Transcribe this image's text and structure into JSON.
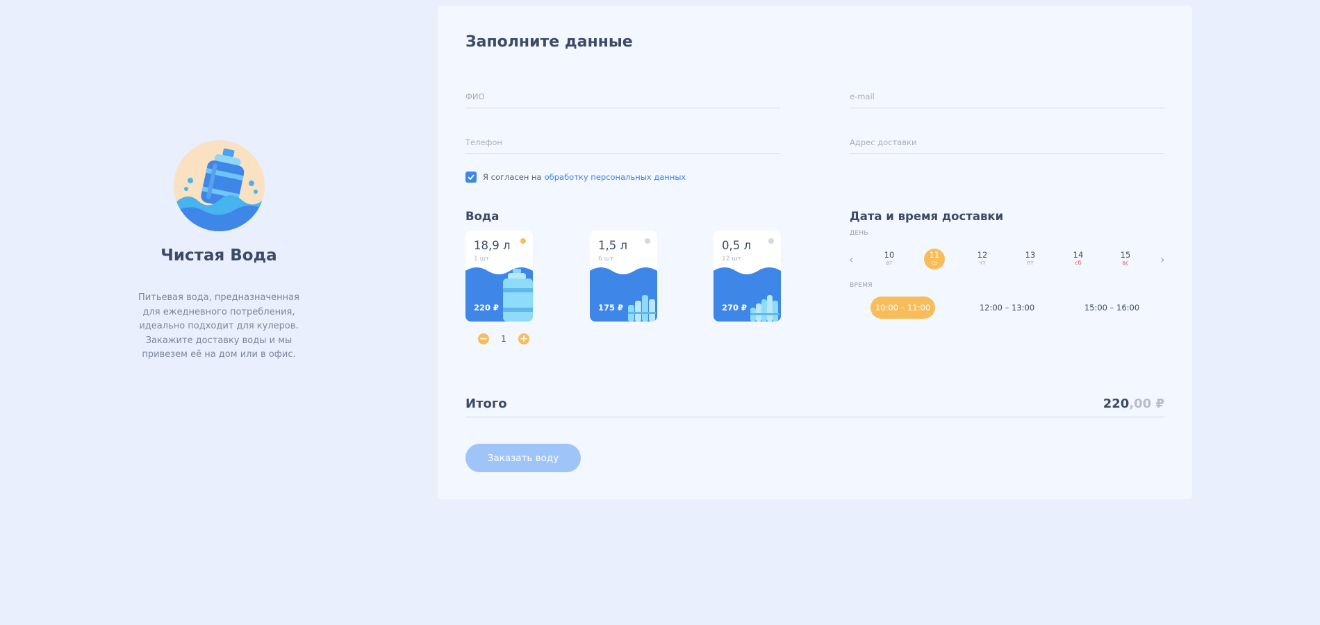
{
  "brand": {
    "name": "Чистая Вода",
    "description": "Питьевая вода, предназначенная\nдля ежедневного потребления,\nидеально подходит для кулеров.\nЗакажите доставку воды и мы\nпривезем её на дом или в офис."
  },
  "form": {
    "title": "Заполните данные",
    "fields": {
      "name_placeholder": "ФИО",
      "email_placeholder": "e-mail",
      "phone_placeholder": "Телефон",
      "address_placeholder": "Адрес доставки"
    },
    "consent": {
      "checked": true,
      "text": "Я согласен на",
      "link": "обработку персональных данных"
    }
  },
  "water": {
    "title": "Вода",
    "products": [
      {
        "volume": "18,9 л",
        "qty": "1 шт",
        "price": "220 ₽",
        "selected": true
      },
      {
        "volume": "1,5 л",
        "qty": "6 шт",
        "price": "175 ₽",
        "selected": false
      },
      {
        "volume": "0,5 л",
        "qty": "12 шт",
        "price": "270 ₽",
        "selected": false
      }
    ],
    "stepper": {
      "value": "1",
      "minus": "−",
      "plus": "+"
    }
  },
  "delivery": {
    "title": "Дата и время доставки",
    "day_label": "день",
    "time_label": "время",
    "days": [
      {
        "num": "10",
        "dow": "вт",
        "active": false,
        "weekend": false
      },
      {
        "num": "11",
        "dow": "ср",
        "active": true,
        "weekend": false
      },
      {
        "num": "12",
        "dow": "чт",
        "active": false,
        "weekend": false
      },
      {
        "num": "13",
        "dow": "пт",
        "active": false,
        "weekend": false
      },
      {
        "num": "14",
        "dow": "сб",
        "active": false,
        "weekend": true
      },
      {
        "num": "15",
        "dow": "вс",
        "active": false,
        "weekend": true
      }
    ],
    "slots": [
      {
        "label": "10:00 – 11:00",
        "active": true
      },
      {
        "label": "12:00 – 13:00",
        "active": false
      },
      {
        "label": "15:00 – 16:00",
        "active": false
      }
    ],
    "prev_icon": "chevron-left-icon",
    "next_icon": "chevron-right-icon"
  },
  "total": {
    "label": "Итого",
    "integer": "220",
    "decimals": ",00 ₽"
  },
  "order_button": "Заказать воду",
  "colors": {
    "accent_blue": "#3e86e8",
    "accent_orange": "#f7bd5a",
    "background": "#e9effc",
    "card": "#f3f7ff"
  }
}
